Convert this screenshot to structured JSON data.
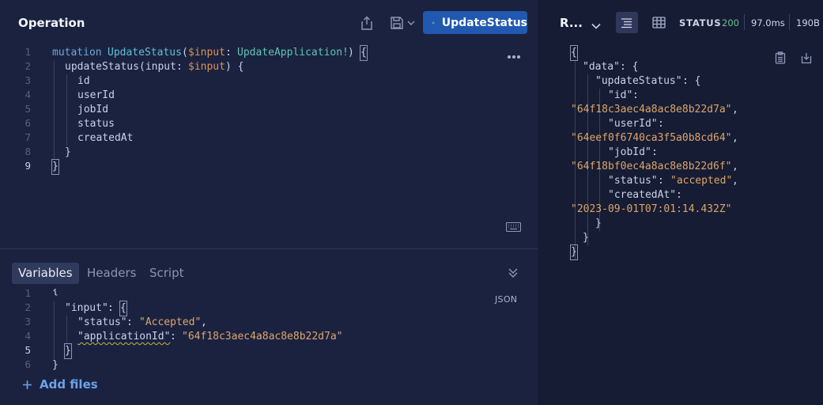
{
  "operation": {
    "title": "Operation",
    "run_label": "UpdateStatus",
    "line_numbers": [
      "1",
      "2",
      "3",
      "4",
      "5",
      "6",
      "7",
      "8",
      "9"
    ],
    "code": {
      "l1_kw": "mutation",
      "l1_name": "UpdateStatus",
      "l1_paren": "(",
      "l1_var": "$input",
      "l1_colon": ": ",
      "l1_type": "UpdateApplication!",
      "l1_close": ") ",
      "l1_brace": "{",
      "l2_fn": "updateStatus",
      "l2_args1": "(input: ",
      "l2_var": "$input",
      "l2_args2": ") {",
      "l3": "id",
      "l4": "userId",
      "l5": "jobId",
      "l6": "status",
      "l7": "createdAt",
      "l8": "}",
      "l9": "}"
    }
  },
  "variables": {
    "tabs": [
      "Variables",
      "Headers",
      "Script"
    ],
    "format_label": "JSON",
    "line_numbers": [
      "1",
      "2",
      "3",
      "4",
      "5",
      "6"
    ],
    "code": {
      "l1": "{",
      "l2_key": "\"input\"",
      "l2_rest": ": ",
      "l2_brace": "{",
      "l3_key": "\"status\"",
      "l3_sep": ": ",
      "l3_val": "\"Accepted\"",
      "l3_end": ",",
      "l4_key": "\"applicationId\"",
      "l4_sep": ": ",
      "l4_val": "\"64f18c3aec4a8ac8e8b22d7a\"",
      "l5": "}",
      "l6": "}"
    },
    "add_files_label": "Add files"
  },
  "response": {
    "title": "R...",
    "status_label": "STATUS",
    "status_code": "200",
    "time": "97.0ms",
    "size": "190B",
    "lines": {
      "l1": "{",
      "l2_key": "\"data\"",
      "l2_rest": ": {",
      "l3_key": "\"updateStatus\"",
      "l3_rest": ": {",
      "l4_key": "\"id\"",
      "l4_rest": ":",
      "l5_val": "\"64f18c3aec4a8ac8e8b22d7a\"",
      "l5_end": ",",
      "l6_key": "\"userId\"",
      "l6_rest": ":",
      "l7_val": "\"64eef0f6740ca3f5a0b8cd64\"",
      "l7_end": ",",
      "l8_key": "\"jobId\"",
      "l8_rest": ":",
      "l9_val": "\"64f18bf0ec4a8ac8e8b22d6f\"",
      "l9_end": ",",
      "l10_key": "\"status\"",
      "l10_sep": ": ",
      "l10_val": "\"accepted\"",
      "l10_end": ",",
      "l11_key": "\"createdAt\"",
      "l11_rest": ":",
      "l12_val": "\"2023-09-01T07:01:14.432Z\"",
      "l13": "}",
      "l14": "}",
      "l15": "}"
    }
  },
  "icons": {
    "share": "share-icon",
    "save": "save-icon",
    "play": "play-icon",
    "more": "more-horizontal-icon",
    "keyboard": "keyboard-icon",
    "collapse": "chevrons-down-icon",
    "plus": "plus-icon",
    "text_view": "text-view-icon",
    "table_view": "table-view-icon",
    "copy": "clipboard-icon",
    "download": "download-icon"
  },
  "colors": {
    "accent": "#2159b0",
    "status_ok": "#67c28a",
    "keyword": "#6da8d8",
    "string": "#dca56a"
  }
}
